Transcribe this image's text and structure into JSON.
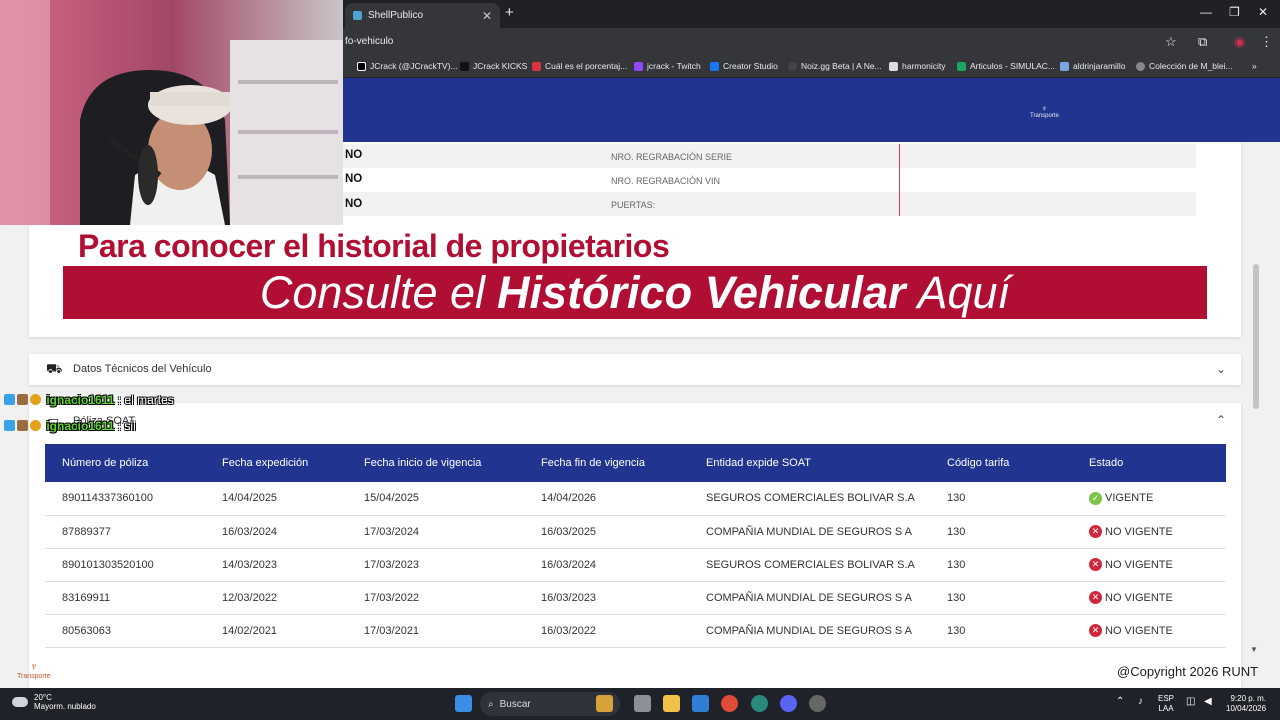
{
  "browser": {
    "tab_title": "ShellPublico",
    "url": "fo-vehiculo",
    "bookmarks": [
      "JCrack (@JCrackTV)...",
      "JCrack KICKS",
      "Cuál es el porcentaj...",
      "jcrack - Twitch",
      "Creator Studio",
      "Noiz.gg Beta | A Ne...",
      "harmonicity",
      "Articulos - SIMULAC...",
      "aldrinjaramillo",
      "Colección de M_blei..."
    ]
  },
  "header": {
    "logo_text": "Transporte"
  },
  "details": [
    {
      "value": "NO",
      "label": "NRO. REGRABACIÓN SERIE"
    },
    {
      "value": "NO",
      "label": "NRO. REGRABACIÓN VIN"
    },
    {
      "value": "NO",
      "label": "PUERTAS:"
    }
  ],
  "banner": {
    "line1": "Para conocer el historial de propietarios",
    "line2_a": "Consulte el",
    "line2_b": "Histórico Vehicular",
    "line2_c": "Aquí"
  },
  "accordion_tech": {
    "label": "Datos Técnicos del Vehículo"
  },
  "accordion_soat": {
    "label": "Póliza SOAT"
  },
  "soat_table": {
    "headers": [
      "Número de póliza",
      "Fecha expedición",
      "Fecha inicio de vigencia",
      "Fecha fin de vigencia",
      "Entidad expide SOAT",
      "Código tarifa",
      "Estado"
    ],
    "rows": [
      [
        "890114337360100",
        "14/04/2025",
        "15/04/2025",
        "14/04/2026",
        "SEGUROS COMERCIALES BOLIVAR S.A",
        "130",
        "VIGENTE"
      ],
      [
        "87889377",
        "16/03/2024",
        "17/03/2024",
        "16/03/2025",
        "COMPAÑIA MUNDIAL DE SEGUROS S A",
        "130",
        "NO VIGENTE"
      ],
      [
        "890101303520100",
        "14/03/2023",
        "17/03/2023",
        "16/03/2024",
        "SEGUROS COMERCIALES BOLIVAR S.A",
        "130",
        "NO VIGENTE"
      ],
      [
        "83169911",
        "12/03/2022",
        "17/03/2022",
        "16/03/2023",
        "COMPAÑIA MUNDIAL DE SEGUROS S A",
        "130",
        "NO VIGENTE"
      ],
      [
        "80563063",
        "14/02/2021",
        "17/03/2021",
        "16/03/2022",
        "COMPAÑIA MUNDIAL DE SEGUROS S A",
        "130",
        "NO VIGENTE"
      ]
    ]
  },
  "footer": {
    "copyright": "@Copyright 2026 RUNT",
    "logo_text": "Transporte"
  },
  "chat": [
    {
      "user": "ignacio1611",
      "message": ": el martes"
    },
    {
      "user": "ignacio1611",
      "message": ": sii"
    }
  ],
  "taskbar": {
    "temp": "20°C",
    "weather": "Mayorm. nublado",
    "search": "Buscar",
    "lang": "ESP",
    "lang2": "LAA",
    "time": "9:20 p. m.",
    "date": "10/04/2026"
  },
  "colors": {
    "header_blue": "#21348f",
    "banner_red": "#b10e33",
    "ok_green": "#7bc44a",
    "no_red": "#d0273c"
  }
}
